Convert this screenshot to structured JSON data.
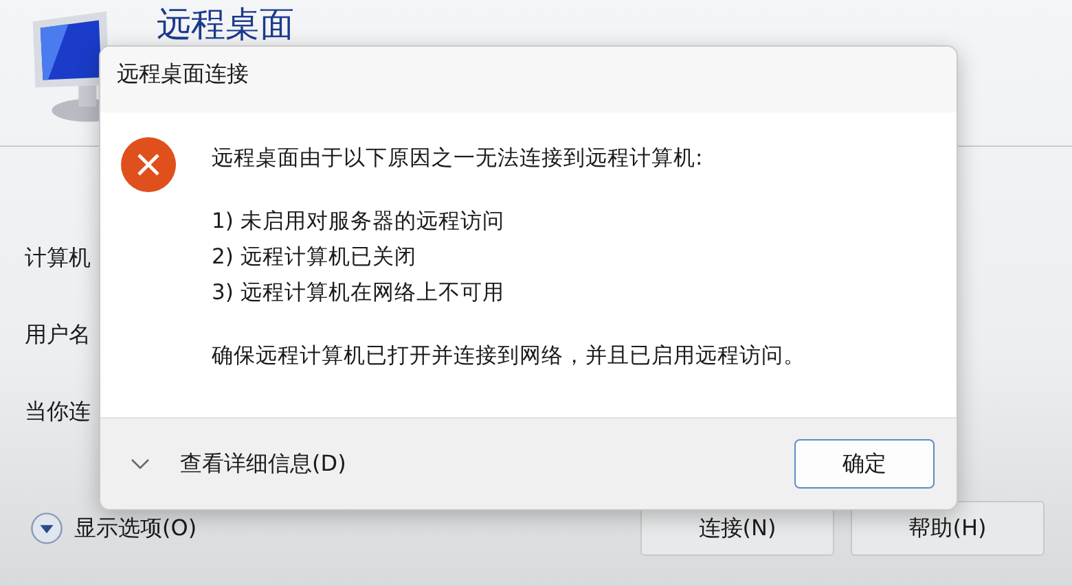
{
  "background_window": {
    "title": "远程桌面",
    "labels": [
      "计算机",
      "用户名",
      "当你连"
    ],
    "show_options": "显示选项(O)",
    "buttons": [
      "连接(N)",
      "帮助(H)"
    ]
  },
  "dialog": {
    "title": "远程桌面连接",
    "message": "远程桌面由于以下原因之一无法连接到远程计算机:",
    "reasons": [
      "1) 未启用对服务器的远程访问",
      "2) 远程计算机已关闭",
      "3) 远程计算机在网络上不可用"
    ],
    "advice": "确保远程计算机已打开并连接到网络，并且已启用远程访问。",
    "details": {
      "label": "查看详细信息(D)",
      "expanded": false
    },
    "ok_button": "确定"
  }
}
